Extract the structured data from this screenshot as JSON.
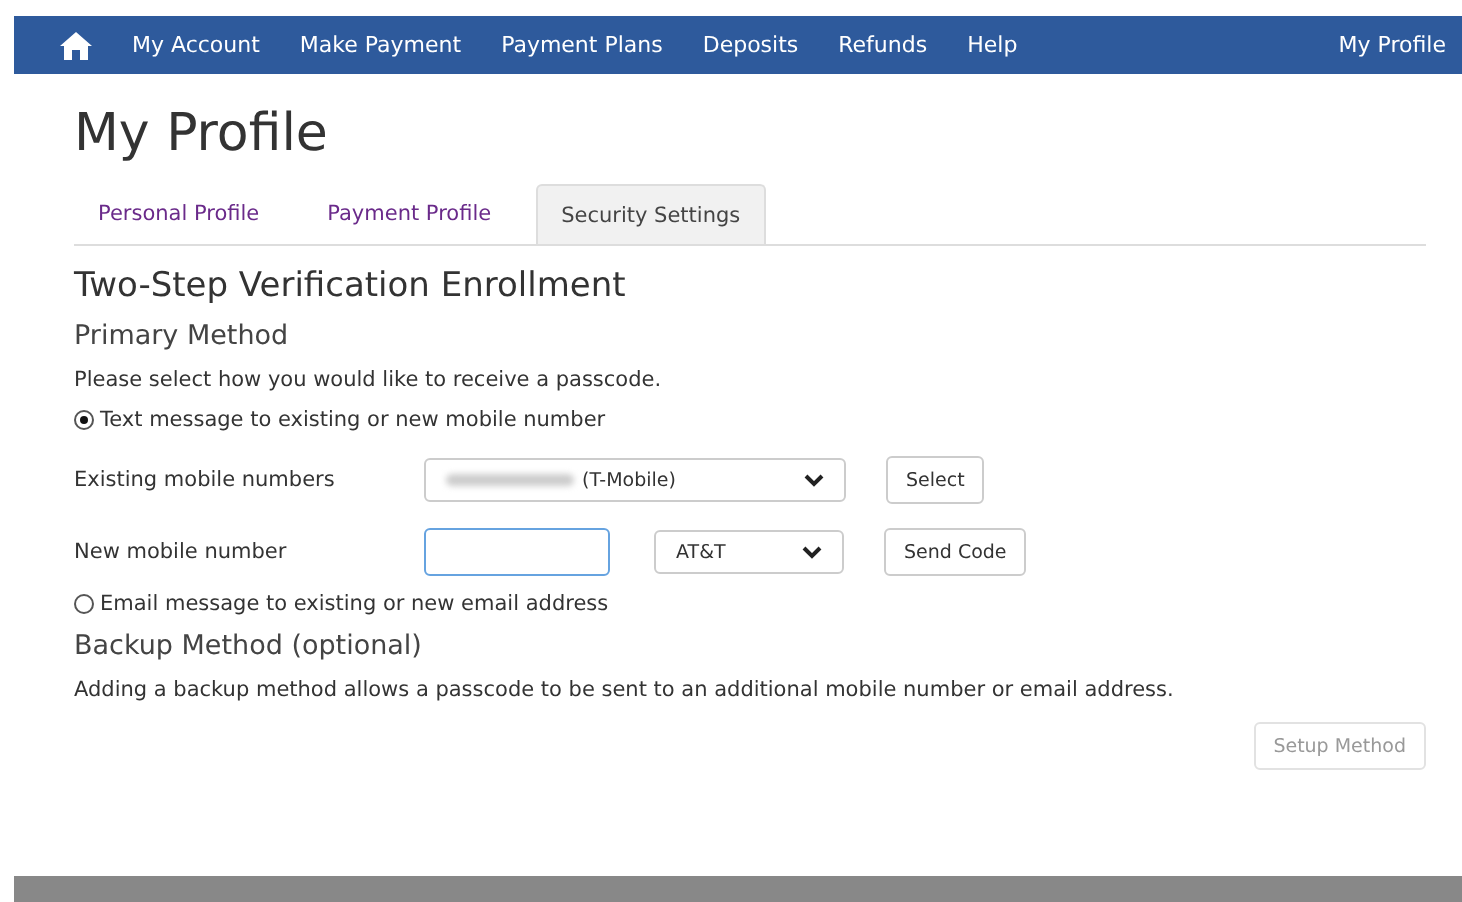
{
  "nav": {
    "items": [
      "My Account",
      "Make Payment",
      "Payment Plans",
      "Deposits",
      "Refunds",
      "Help"
    ],
    "profile_link": "My Profile"
  },
  "page_title": "My Profile",
  "tabs": [
    {
      "label": "Personal Profile",
      "selected": false
    },
    {
      "label": "Payment Profile",
      "selected": false
    },
    {
      "label": "Security Settings",
      "selected": true
    }
  ],
  "section_title": "Two-Step Verification Enrollment",
  "primary": {
    "heading": "Primary Method",
    "instruction": "Please select how you would like to receive a passcode.",
    "text_option": {
      "label": "Text message to existing or new mobile number",
      "selected": true
    },
    "existing": {
      "label": "Existing mobile numbers",
      "value": "(T-Mobile)",
      "button": "Select"
    },
    "new": {
      "label": "New mobile number",
      "carrier": "AT&T",
      "button": "Send Code"
    },
    "email_option": {
      "label": "Email message to existing or new email address",
      "selected": false
    }
  },
  "backup": {
    "heading": "Backup Method (optional)",
    "description": "Adding a backup method allows a passcode to be sent to an additional mobile number or email address.",
    "button": {
      "label": "Setup Method",
      "disabled": true
    }
  }
}
